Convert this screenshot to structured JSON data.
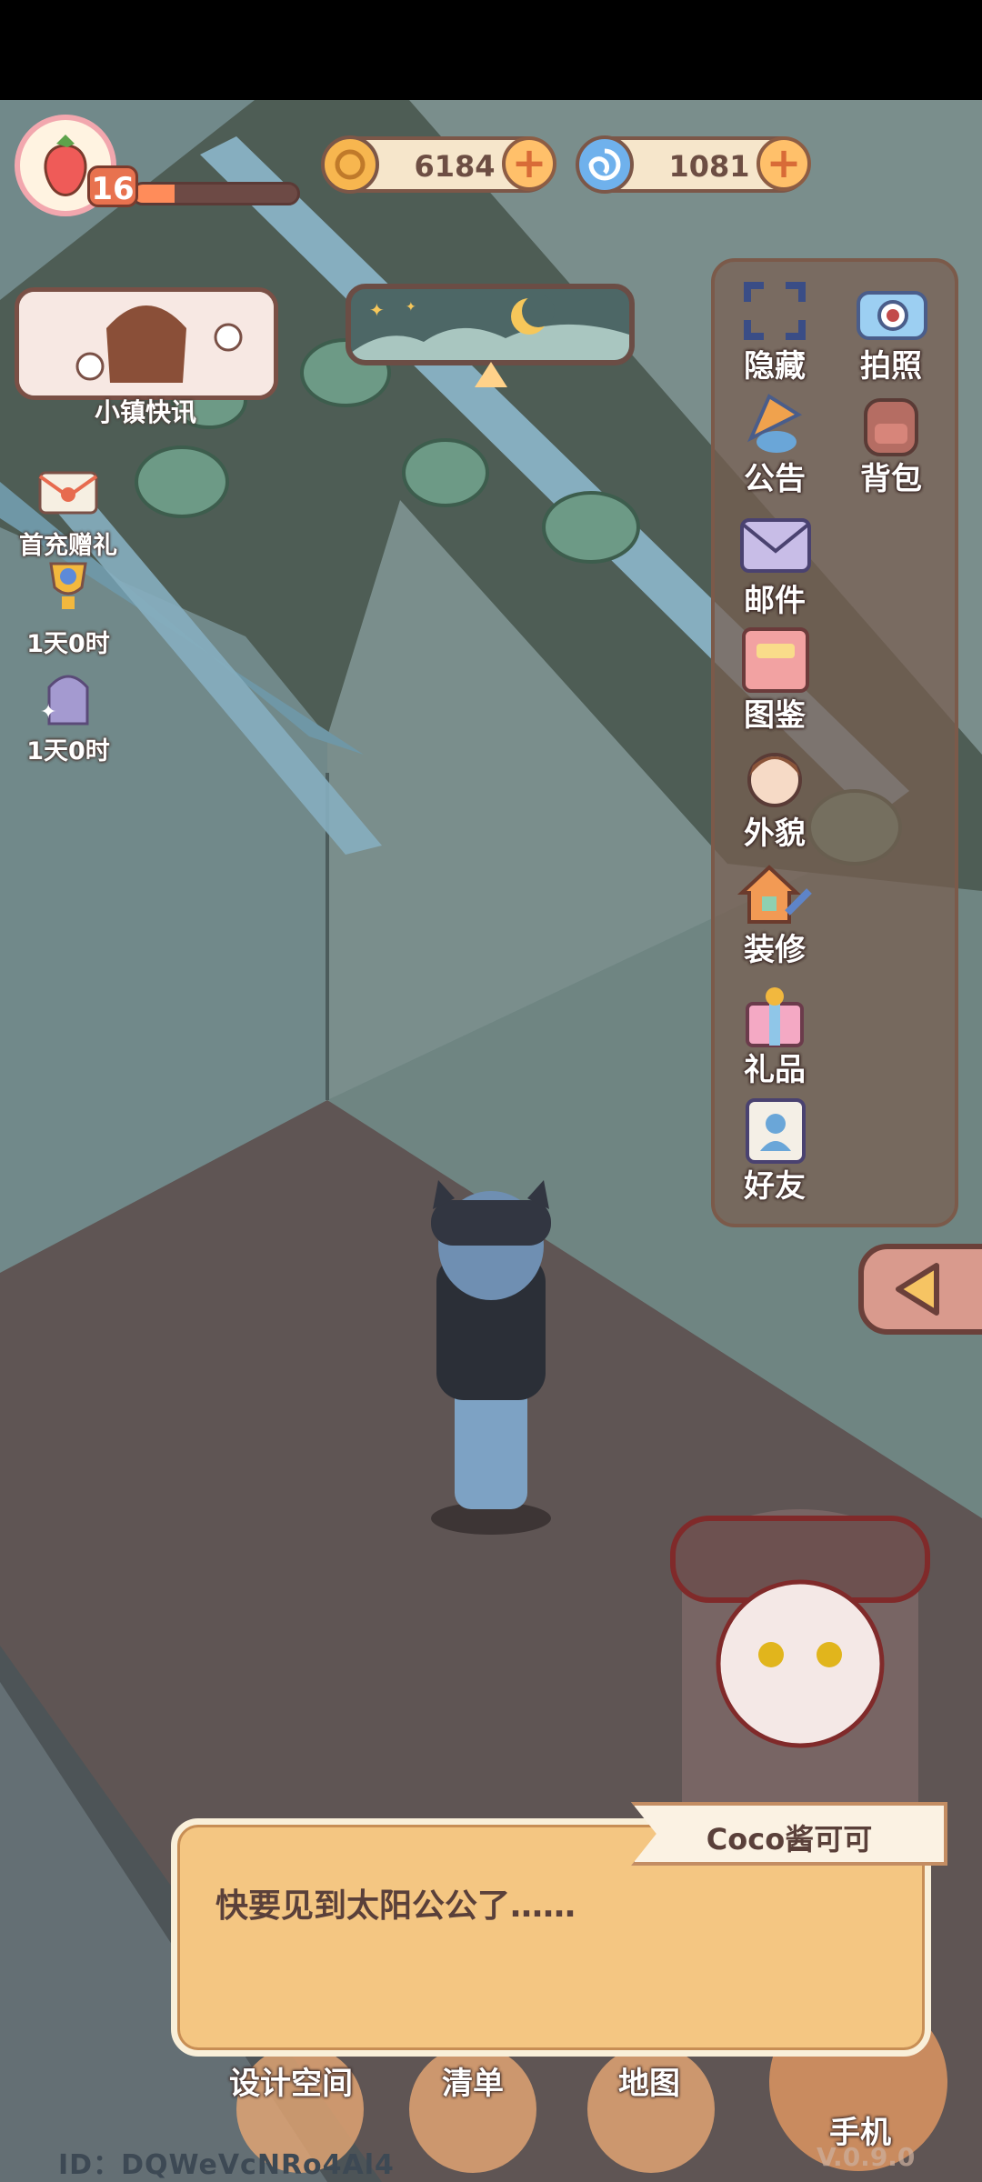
{
  "hud": {
    "level": "16",
    "level_progress_percent": 25,
    "coins": {
      "value": "6184",
      "icon": "gold-coin-icon",
      "add_icon": "plus-icon"
    },
    "gems": {
      "value": "1081",
      "icon": "blue-swirl-gem-icon",
      "add_icon": "plus-icon"
    }
  },
  "left_panel": {
    "news_label": "小镇快讯",
    "items": [
      {
        "label": "首充赠礼",
        "icon": "gift-envelope-icon"
      },
      {
        "label": "1天0时",
        "icon": "trophy-icon"
      },
      {
        "label": "1天0时",
        "icon": "arch-card-icon"
      }
    ]
  },
  "menu": {
    "items": [
      {
        "label": "隐藏",
        "icon": "hide-frame-icon"
      },
      {
        "label": "拍照",
        "icon": "camera-icon"
      },
      {
        "label": "公告",
        "icon": "announcement-icon"
      },
      {
        "label": "背包",
        "icon": "backpack-icon"
      },
      {
        "label": "邮件",
        "icon": "mail-icon"
      },
      {
        "label": "图鉴",
        "icon": "catalog-book-icon"
      },
      {
        "label": "外貌",
        "icon": "character-face-icon"
      },
      {
        "label": "装修",
        "icon": "house-wrench-icon"
      },
      {
        "label": "礼品",
        "icon": "gift-box-icon"
      },
      {
        "label": "好友",
        "icon": "friends-book-icon"
      }
    ],
    "collapse_icon": "triangle-left-icon"
  },
  "dialog": {
    "speaker": "Coco酱可可",
    "text": "快要见到太阳公公了……"
  },
  "bottom_nav": {
    "design": "设计空间",
    "list": "清单",
    "map": "地图",
    "phone": "手机"
  },
  "footer": {
    "player_id": "ID：DQWeVcNRo4Al4",
    "version": "V.0.9.0"
  },
  "colors": {
    "floor": "#5f5554",
    "wall": "#72898a",
    "roof": "#4e5f55",
    "panel_brown": "#7b5a4a",
    "dialog": "#f4c682"
  }
}
